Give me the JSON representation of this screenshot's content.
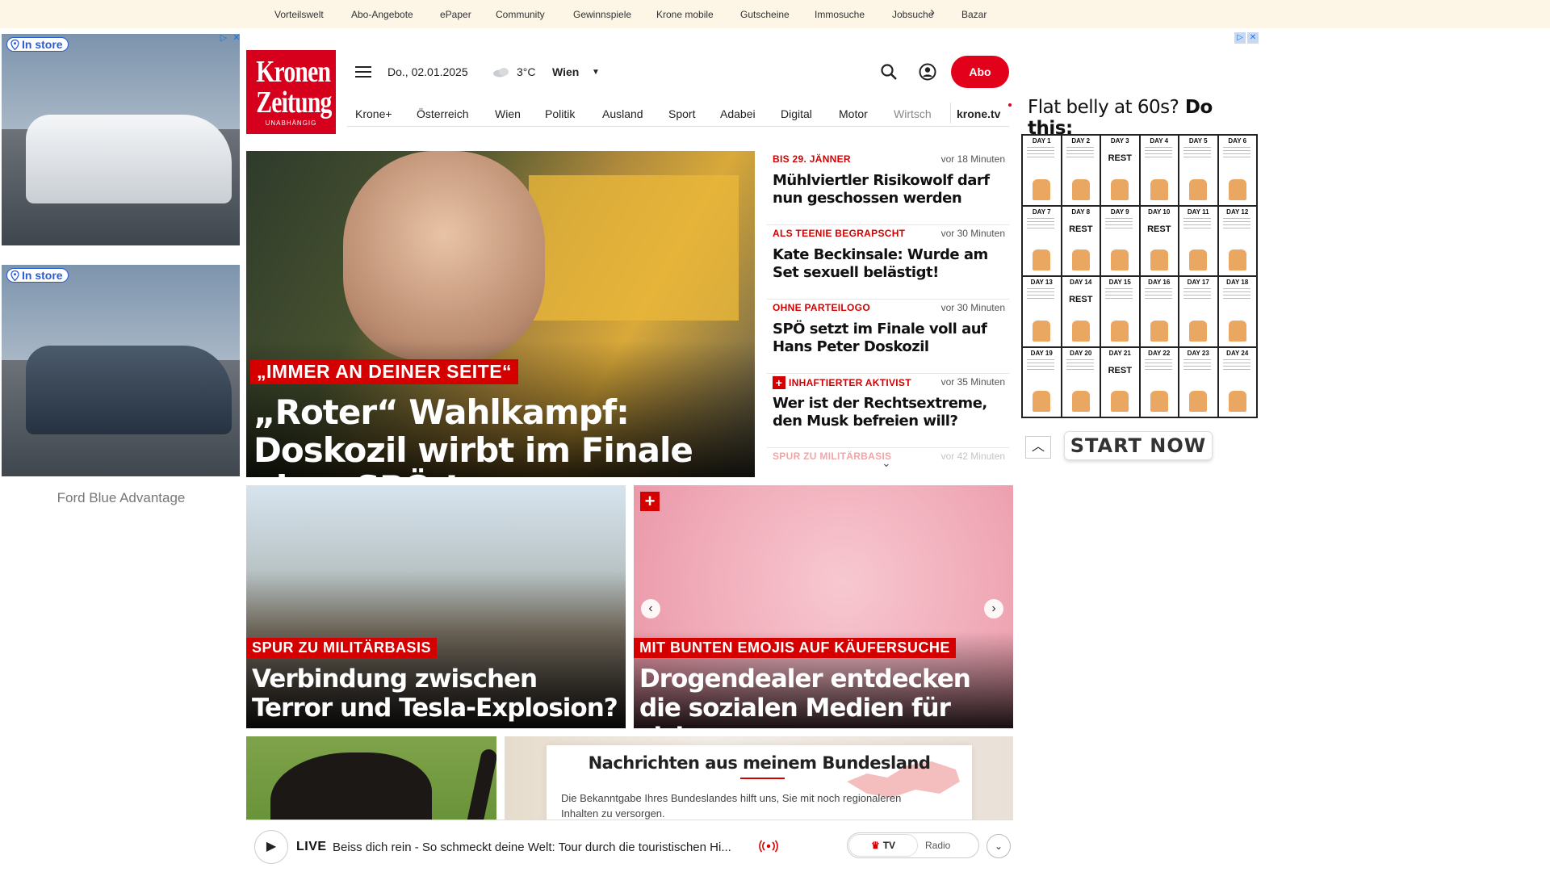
{
  "topbar": {
    "links": [
      "Vorteilswelt",
      "Abo-Angebote",
      "ePaper",
      "Community",
      "Gewinnspiele",
      "Krone mobile",
      "Gutscheine",
      "Immosuche",
      "Jobsuche",
      "Bazar"
    ]
  },
  "left_ads": {
    "badge": "In store",
    "caption": "Ford Blue Advantage"
  },
  "header": {
    "logo_line1": "Kronen",
    "logo_line2": "Zeitung",
    "logo_tagline": "UNABHÄNGIG",
    "date": "Do., 02.01.2025",
    "temperature": "3°C",
    "city": "Wien",
    "abo_label": "Abo"
  },
  "nav": {
    "items": [
      "Krone+",
      "Österreich",
      "Wien",
      "Politik",
      "Ausland",
      "Sport",
      "Adabei",
      "Digital",
      "Motor",
      "Wirtsch"
    ],
    "krone_tv": "krone.tv"
  },
  "hero": {
    "kicker": "„IMMER AN DEINER SEITE“",
    "headline": "„Roter“ Wahlkampf: Doskozil wirbt im Finale ohne SPÖ-Logo"
  },
  "latest": [
    {
      "tag": "BIS 29. JÄNNER",
      "time": "vor 18 Minuten",
      "title": "Mühlviertler Risikowolf darf nun geschossen werden",
      "plus": false
    },
    {
      "tag": "ALS TEENIE BEGRAPSCHT",
      "time": "vor 30 Minuten",
      "title": "Kate Beckinsale: Wurde am Set sexuell belästigt!",
      "plus": false
    },
    {
      "tag": "OHNE PARTEILOGO",
      "time": "vor 30 Minuten",
      "title": "SPÖ setzt im Finale voll auf Hans Peter Doskozil",
      "plus": false
    },
    {
      "tag": "INHAFTIERTER AKTIVIST",
      "time": "vor 35 Minuten",
      "title": "Wer ist der Rechtsextreme, den Musk befreien will?",
      "plus": true
    },
    {
      "tag": "SPUR ZU MILITÄRBASIS",
      "time": "vor 42 Minuten",
      "title": "",
      "plus": false
    }
  ],
  "tiles": [
    {
      "kicker": "SPUR ZU MILITÄRBASIS",
      "headline": "Verbindung zwischen Terror und Tesla-Explosion?"
    },
    {
      "kicker": "MIT BUNTEN EMOJIS AUF KÄUFERSUCHE",
      "headline": "Drogendealer entdecken die sozialen Medien für sich"
    }
  ],
  "bundesland": {
    "title": "Nachrichten aus meinem Bundesland",
    "text": "Die Bekanntgabe Ihres Bundeslandes hilft uns, Sie mit noch regionaleren Inhalten zu versorgen."
  },
  "player": {
    "live_label": "LIVE",
    "live_text": "Beiss dich rein - So schmeckt deine Welt: Tour durch die touristischen Hi...",
    "tv_label": "TV",
    "radio_label": "Radio"
  },
  "right_ad": {
    "headline_bold": "Flat belly at 60s?",
    "headline_rest": "Do this:",
    "days": [
      "DAY 1",
      "DAY 2",
      "DAY 3",
      "DAY 4",
      "DAY 5",
      "DAY 6",
      "DAY 7",
      "DAY 8",
      "DAY 9",
      "DAY 10",
      "DAY 11",
      "DAY 12",
      "DAY 13",
      "DAY 14",
      "DAY 15",
      "DAY 16",
      "DAY 17",
      "DAY 18",
      "DAY 19",
      "DAY 20",
      "DAY 21",
      "DAY 22",
      "DAY 23",
      "DAY 24"
    ],
    "rest_days": [
      "DAY 3",
      "DAY 8",
      "DAY 10",
      "DAY 14",
      "DAY 21"
    ],
    "rest_label": "REST",
    "cta": "START NOW"
  },
  "colors": {
    "brand_red": "#d40000",
    "topbar_bg": "#fdf5e6",
    "ad_blue": "#2a5bd7"
  }
}
